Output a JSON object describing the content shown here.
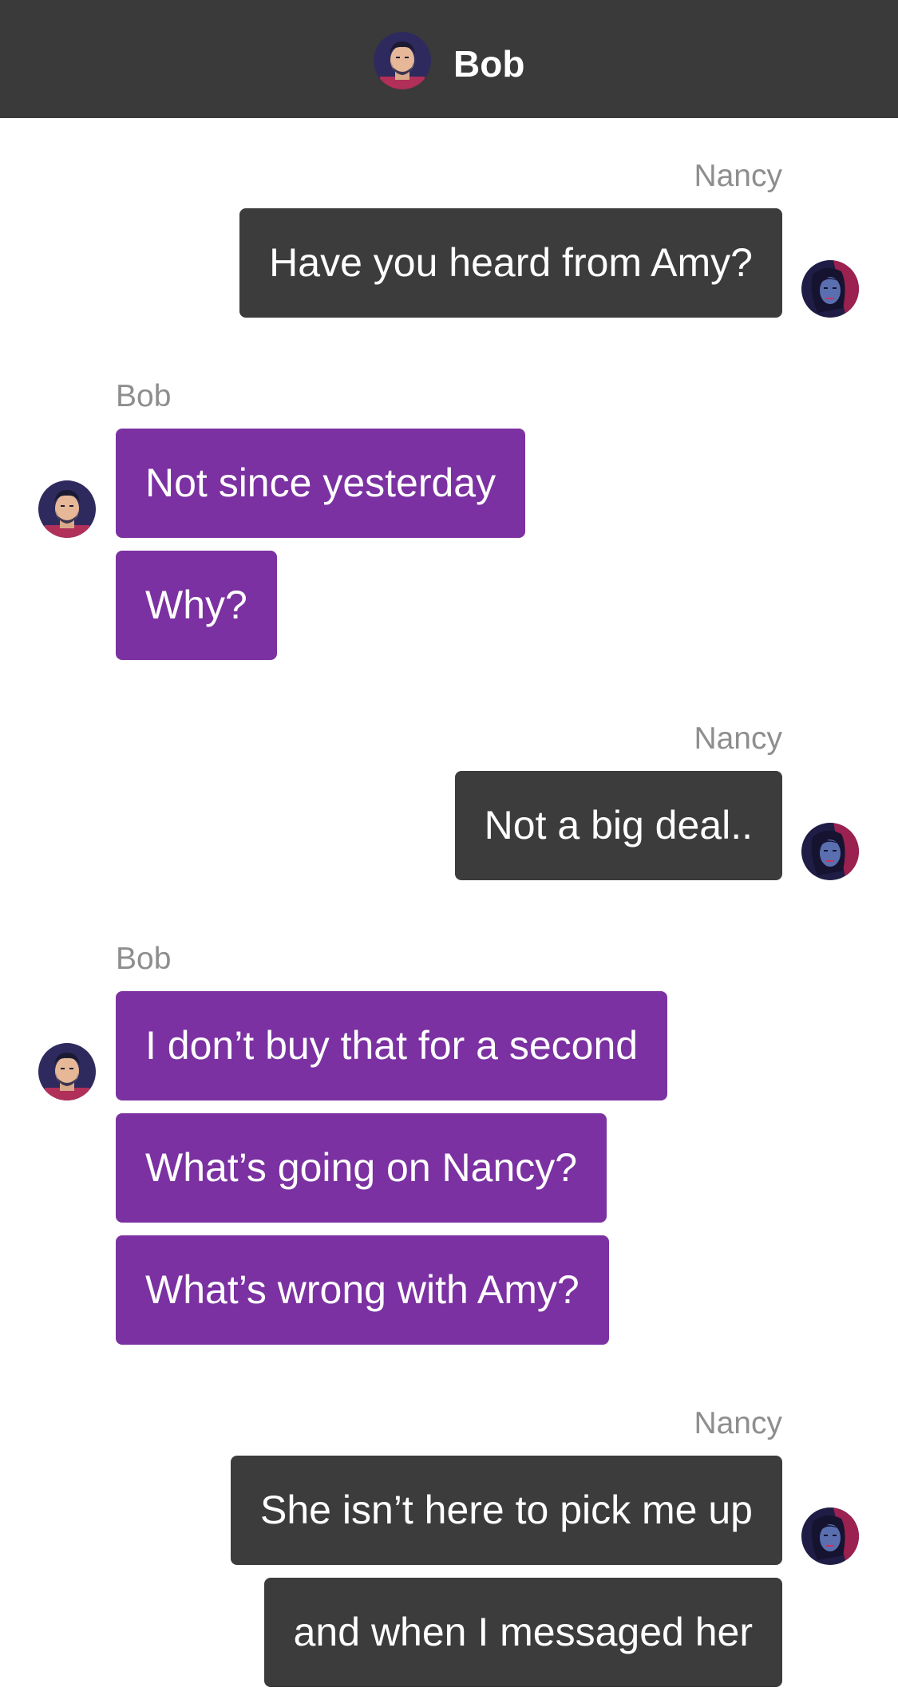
{
  "header": {
    "title": "Bob",
    "avatar_icon": "bob-avatar-icon"
  },
  "colors": {
    "header_bg": "#3a3a3a",
    "nancy_bubble": "#3c3c3c",
    "bob_bubble": "#7b31a1",
    "sender_label": "#8e8e8e"
  },
  "messages": {
    "g1": {
      "sender": "Nancy",
      "texts": [
        "Have you heard from Amy?"
      ]
    },
    "g2": {
      "sender": "Bob",
      "texts": [
        "Not since yesterday",
        "Why?"
      ]
    },
    "g3": {
      "sender": "Nancy",
      "texts": [
        "Not a big deal.."
      ]
    },
    "g4": {
      "sender": "Bob",
      "texts": [
        "I don’t buy that for a second",
        "What’s going on Nancy?",
        "What’s wrong with Amy?"
      ]
    },
    "g5": {
      "sender": "Nancy",
      "texts": [
        "She isn’t here to pick me up",
        "and when I messaged her"
      ]
    }
  }
}
